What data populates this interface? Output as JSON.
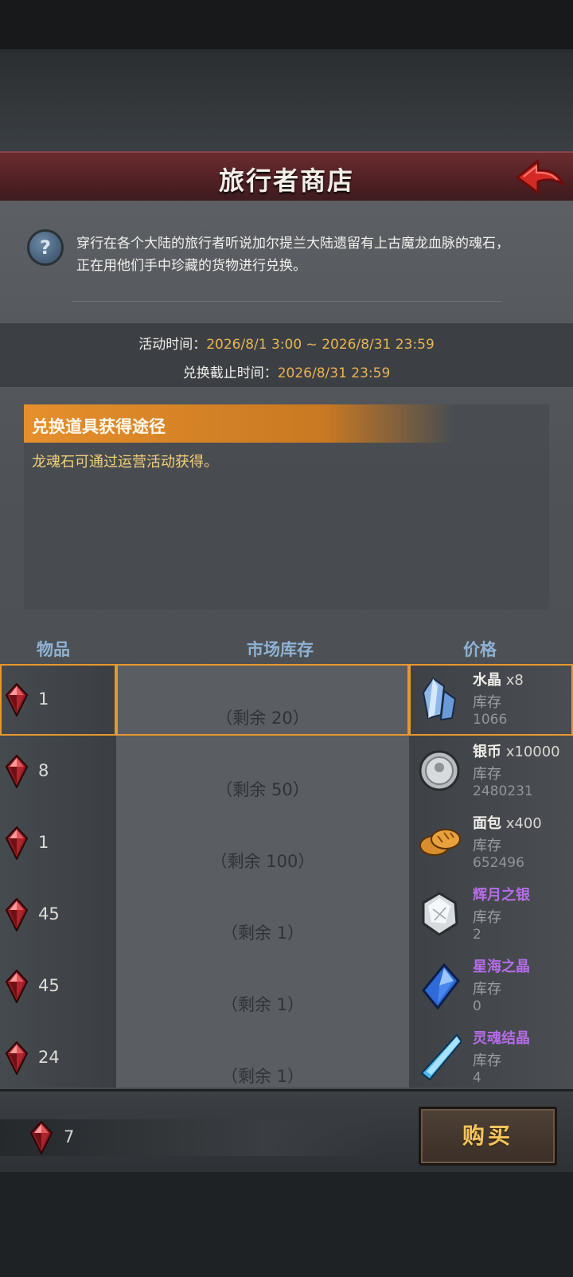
{
  "header": {
    "title": "旅行者商店"
  },
  "info": {
    "description": "穿行在各个大陆的旅行者听说加尔提兰大陆遗留有上古魔龙血脉的魂石，正在用他们手中珍藏的货物进行兑换。",
    "activity_label": "活动时间：",
    "activity_value": "2026/8/1 3:00 ~ 2026/8/31 23:59",
    "deadline_label": "兑换截止时间：",
    "deadline_value": "2026/8/31 23:59"
  },
  "acquire": {
    "title": "兑换道具获得途径",
    "text": "龙魂石可通过运营活动获得。"
  },
  "columns": {
    "item": "物品",
    "stock": "市场库存",
    "price": "价格"
  },
  "rows": [
    {
      "qty": "1",
      "remain": "（剩余 20）",
      "name": "水晶",
      "mult": " x8",
      "stock_label": "库存",
      "stock_value": "1066",
      "icon": "crystal-icon",
      "rarity": "common"
    },
    {
      "qty": "8",
      "remain": "（剩余 50）",
      "name": "银币",
      "mult": " x10000",
      "stock_label": "库存",
      "stock_value": "2480231",
      "icon": "silver-coin-icon",
      "rarity": "common"
    },
    {
      "qty": "1",
      "remain": "（剩余 100）",
      "name": "面包",
      "mult": " x400",
      "stock_label": "库存",
      "stock_value": "652496",
      "icon": "bread-icon",
      "rarity": "common"
    },
    {
      "qty": "45",
      "remain": "（剩余 1）",
      "name": "辉月之银",
      "mult": "",
      "stock_label": "库存",
      "stock_value": "2",
      "icon": "moon-silver-icon",
      "rarity": "epic"
    },
    {
      "qty": "45",
      "remain": "（剩余 1）",
      "name": "星海之晶",
      "mult": "",
      "stock_label": "库存",
      "stock_value": "0",
      "icon": "star-crystal-icon",
      "rarity": "epic"
    },
    {
      "qty": "24",
      "remain": "（剩余 1）",
      "name": "灵魂结晶",
      "mult": "",
      "stock_label": "库存",
      "stock_value": "4",
      "icon": "soul-crystal-icon",
      "rarity": "epic"
    }
  ],
  "selected_row": 0,
  "footer": {
    "owned": "7",
    "buy_label": "购买"
  },
  "colors": {
    "accent": "#e8972d",
    "price_epic": "#b56ce8",
    "time_value": "#e8b452"
  }
}
